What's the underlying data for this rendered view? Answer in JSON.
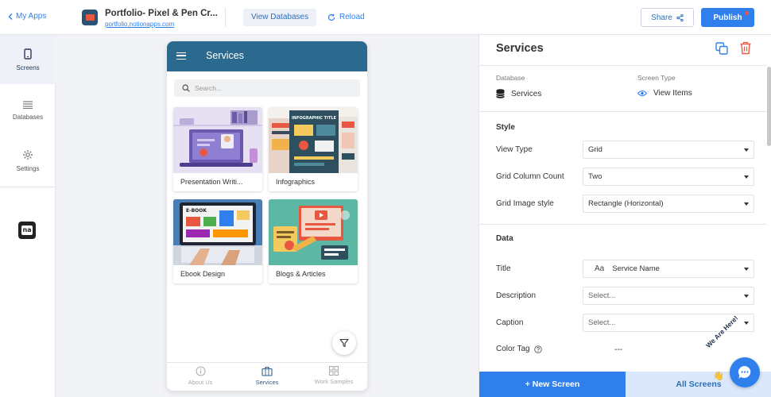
{
  "topbar": {
    "back_label": "My Apps",
    "app_title": "Portfolio- Pixel & Pen Cr...",
    "app_url": "portfolio.notionapps.com",
    "view_databases_label": "View Databases",
    "reload_label": "Reload",
    "share_label": "Share",
    "publish_label": "Publish"
  },
  "leftnav": {
    "items": [
      {
        "label": "Screens",
        "icon": "phone-icon",
        "active": true
      },
      {
        "label": "Databases",
        "icon": "list-icon",
        "active": false
      },
      {
        "label": "Settings",
        "icon": "gear-icon",
        "active": false
      }
    ],
    "logo_text": "na"
  },
  "phone": {
    "title": "Services",
    "search_placeholder": "Search...",
    "cards": [
      {
        "label": "Presentation Writi..."
      },
      {
        "label": "Infographics"
      },
      {
        "label": "Ebook Design"
      },
      {
        "label": "Blogs & Articles"
      }
    ],
    "tabs": [
      {
        "label": "About Us",
        "active": false
      },
      {
        "label": "Services",
        "active": true
      },
      {
        "label": "Work Samples",
        "active": false
      }
    ],
    "card2_img_text": "INFOGRAPHIC TITLE",
    "card3_img_text": "E-BOOK"
  },
  "panel": {
    "title": "Services",
    "database_label": "Database",
    "database_value": "Services",
    "screen_type_label": "Screen Type",
    "screen_type_value": "View Items",
    "style_section": "Style",
    "view_type_label": "View Type",
    "view_type_value": "Grid",
    "grid_column_label": "Grid Column Count",
    "grid_column_value": "Two",
    "grid_image_label": "Grid Image style",
    "grid_image_value": "Rectangle (Horizontal)",
    "data_section": "Data",
    "title_label": "Title",
    "title_aa": "Aa",
    "title_value": "Service Name",
    "description_label": "Description",
    "description_value": "Select...",
    "caption_label": "Caption",
    "caption_value": "Select...",
    "color_tag_label": "Color Tag",
    "color_tag_value": "---",
    "new_screen_label": "+ New Screen",
    "all_screens_label": "All Screens"
  },
  "chat": {
    "text": "We Are Here!"
  },
  "colors": {
    "accent": "#2f80ed",
    "phone_header": "#2b6a8e",
    "delete": "#e8573f"
  }
}
